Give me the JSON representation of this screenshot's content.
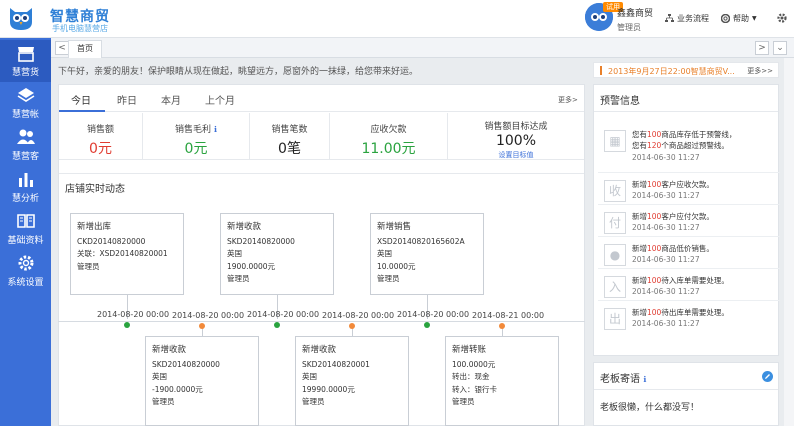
{
  "brand": {
    "name": "智慧商贸",
    "tagline": "手机电脑慧营店"
  },
  "user": {
    "shop": "鑫鑫商贸",
    "role": "管理员",
    "badge": "试用"
  },
  "topnav": {
    "workflow": "业务流程",
    "help": "帮助",
    "help_caret": "▼",
    "settings_icon": "gear-icon"
  },
  "sidebar": {
    "items": [
      {
        "label": "慧营货",
        "icon": "store-icon"
      },
      {
        "label": "慧营帐",
        "icon": "ledger-icon"
      },
      {
        "label": "慧营客",
        "icon": "customers-icon"
      },
      {
        "label": "慧分析",
        "icon": "bar-chart-icon"
      },
      {
        "label": "基础资料",
        "icon": "book-icon"
      },
      {
        "label": "系统设置",
        "icon": "gear-icon"
      }
    ]
  },
  "tabbar": {
    "prev": "<",
    "home": "首页",
    "next": ">",
    "menu": "⌄"
  },
  "greeting": "下午好，亲爱的朋友！保护眼睛从现在做起，眺望远方，愿窗外的一抹绿，给您带来好运。",
  "marquee": {
    "text": "2013年9月27日22:00智慧商贸V...",
    "more": "更多>>"
  },
  "period_tabs": {
    "items": [
      "今日",
      "昨日",
      "本月",
      "上个月"
    ],
    "more": "更多>"
  },
  "stats": [
    {
      "label": "销售额",
      "value": "0元",
      "color": "#e03c31"
    },
    {
      "label": "销售毛利",
      "value": "0元",
      "color": "#2aa33f",
      "info": "ℹ"
    },
    {
      "label": "销售笔数",
      "value": "0笔",
      "color": "#222222"
    },
    {
      "label": "应收欠款",
      "value": "11.00元",
      "color": "#2aa33f"
    },
    {
      "label": "销售额目标达成",
      "value": "100%",
      "color": "#222222",
      "link": "设置目标值"
    }
  ],
  "dynamics": {
    "title": "店铺实时动态",
    "top_cards": [
      {
        "title": "新增出库",
        "lines": [
          "CKD20140820000",
          "关联：XSD20140820001",
          "管理员"
        ]
      },
      {
        "title": "新增收款",
        "lines": [
          "SKD20140820000",
          "英国",
          "1900.0000元",
          "管理员"
        ]
      },
      {
        "title": "新增销售",
        "lines": [
          "XSD20140820165602A",
          "英国",
          "10.0000元",
          "管理员"
        ]
      }
    ],
    "bottom_cards": [
      {
        "title": "新增收款",
        "lines": [
          "SKD20140820000",
          "英国",
          "-1900.0000元",
          "管理员"
        ]
      },
      {
        "title": "新增收款",
        "lines": [
          "SKD20140820001",
          "英国",
          "19990.0000元",
          "管理员"
        ]
      },
      {
        "title": "新增转账",
        "lines": [
          "100.0000元",
          "转出：现金",
          "转入：银行卡",
          "管理员"
        ]
      }
    ],
    "dates": [
      "2014-08-20 00:00",
      "2014-08-20 00:00",
      "2014-08-20 00:00",
      "2014-08-20 00:00",
      "2014-08-20 00:00",
      "2014-08-21 00:00"
    ],
    "dot_colors": {
      "green": "#2aa33f",
      "orange": "#f28a3a"
    }
  },
  "alerts": {
    "title": "预警信息",
    "items": [
      {
        "icon": "box-icon",
        "glyph": "▦",
        "pre": "您有",
        "num": "100",
        "post": "商品库存低于预警线，",
        "pre2": "您有",
        "num2": "120",
        "post2": "个商品超过预警线。",
        "date": "2014-06-30 11:27"
      },
      {
        "icon": "receive-icon",
        "glyph": "收",
        "pre": "新增",
        "num": "100",
        "post": "客户应收欠款。",
        "date": "2014-06-30 11:27"
      },
      {
        "icon": "pay-icon",
        "glyph": "付",
        "pre": "新增",
        "num": "100",
        "post": "客户应付欠款。",
        "date": "2014-06-30 11:27"
      },
      {
        "icon": "price-icon",
        "glyph": "●",
        "pre": "新增",
        "num": "100",
        "post": "商品低价销售。",
        "date": "2014-06-30 11:27"
      },
      {
        "icon": "stock-in-icon",
        "glyph": "入",
        "pre": "新增",
        "num": "100",
        "post": "待入库单需要处理。",
        "date": "2014-06-30 11:27"
      },
      {
        "icon": "stock-out-icon",
        "glyph": "出",
        "pre": "新增",
        "num": "100",
        "post": "待出库单需要处理。",
        "date": "2014-06-30 11:27"
      }
    ]
  },
  "boss": {
    "title": "老板寄语",
    "text": "老板很懒，什么都没写！",
    "info": "ℹ"
  }
}
